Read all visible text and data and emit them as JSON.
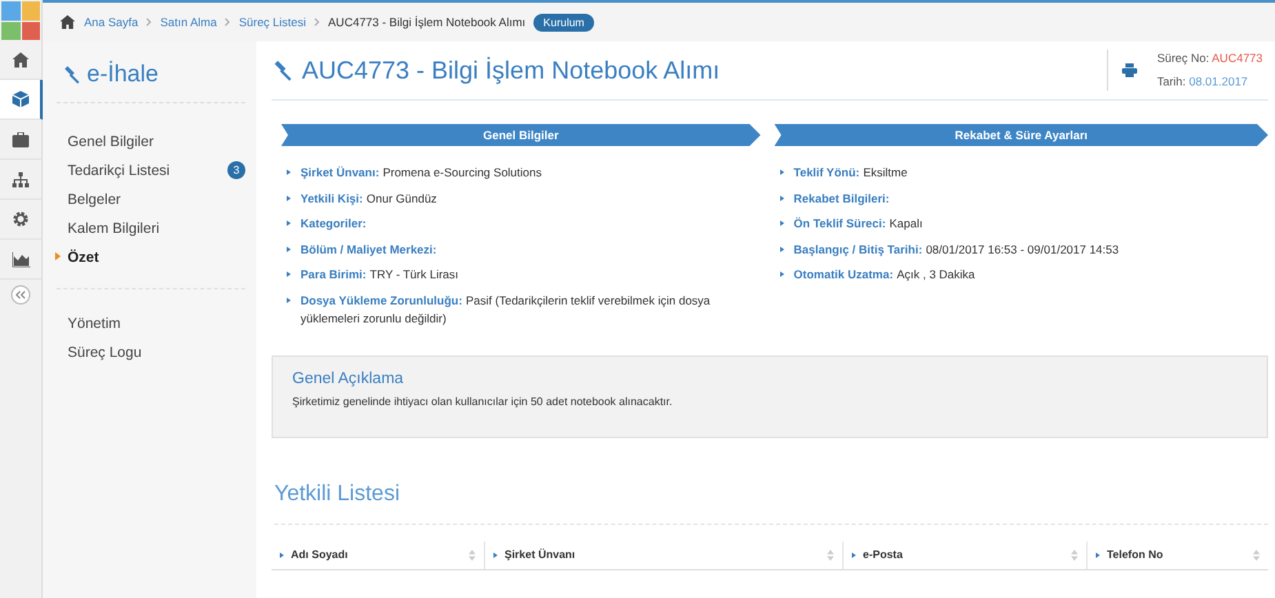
{
  "rail": [
    {
      "kind": "home",
      "selected": false
    },
    {
      "kind": "cube",
      "selected": true
    },
    {
      "kind": "briefcase",
      "selected": false
    },
    {
      "kind": "sitemap",
      "selected": false
    },
    {
      "kind": "gear",
      "selected": false
    },
    {
      "kind": "chart",
      "selected": false
    }
  ],
  "breadcrumb": {
    "items": [
      "Ana Sayfa",
      "Satın Alma",
      "Süreç Listesi"
    ],
    "current": "AUC4773 - Bilgi İşlem Notebook Alımı",
    "status": "Kurulum"
  },
  "sidebar": {
    "title": "e-İhale",
    "items": [
      {
        "label": "Genel Bilgiler",
        "selected": false
      },
      {
        "label": "Tedarikçi Listesi",
        "selected": false,
        "badge": "3"
      },
      {
        "label": "Belgeler",
        "selected": false
      },
      {
        "label": "Kalem Bilgileri",
        "selected": false
      },
      {
        "label": "Özet",
        "selected": true
      }
    ],
    "items2": [
      {
        "label": "Yönetim",
        "selected": false
      },
      {
        "label": "Süreç Logu",
        "selected": false
      }
    ]
  },
  "header": {
    "title": "AUC4773 - Bilgi İşlem Notebook Alımı",
    "process_label": "Süreç No:",
    "process_no": "AUC4773",
    "date_label": "Tarih:",
    "date": "08.01.2017"
  },
  "sections": [
    {
      "title": "Genel Bilgiler",
      "fields": [
        {
          "label": "Şirket Ünvanı:",
          "value": "Promena e-Sourcing Solutions"
        },
        {
          "label": "Yetkili Kişi:",
          "value": "Onur Gündüz"
        },
        {
          "label": "Kategoriler:"
        },
        {
          "label": "Bölüm / Maliyet Merkezi:"
        },
        {
          "label": "Para Birimi:",
          "value": "TRY - Türk Lirası"
        },
        {
          "label": "Dosya Yükleme Zorunluluğu:",
          "value": "Pasif (Tedarikçilerin teklif verebilmek için dosya yüklemeleri zorunlu değildir)"
        }
      ]
    },
    {
      "title": "Rekabet & Süre Ayarları",
      "fields": [
        {
          "label": "Teklif Yönü:",
          "value": "Eksiltme"
        },
        {
          "label": "Rekabet Bilgileri:"
        },
        {
          "label": "Ön Teklif Süreci:",
          "value": "Kapalı"
        },
        {
          "label": "Başlangıç / Bitiş Tarihi:",
          "value": "08/01/2017 16:53 - 09/01/2017 14:53"
        },
        {
          "label": "Otomatik Uzatma:",
          "value": "Açık , 3 Dakika"
        }
      ]
    }
  ],
  "description": {
    "title": "Genel Açıklama",
    "text": "Şirketimiz genelinde ihtiyacı olan kullanıcılar için 50 adet notebook alınacaktır."
  },
  "authorized": {
    "title": "Yetkili Listesi",
    "columns": [
      "Adı Soyadı",
      "Şirket Ünvanı",
      "e-Posta",
      "Telefon No"
    ]
  }
}
